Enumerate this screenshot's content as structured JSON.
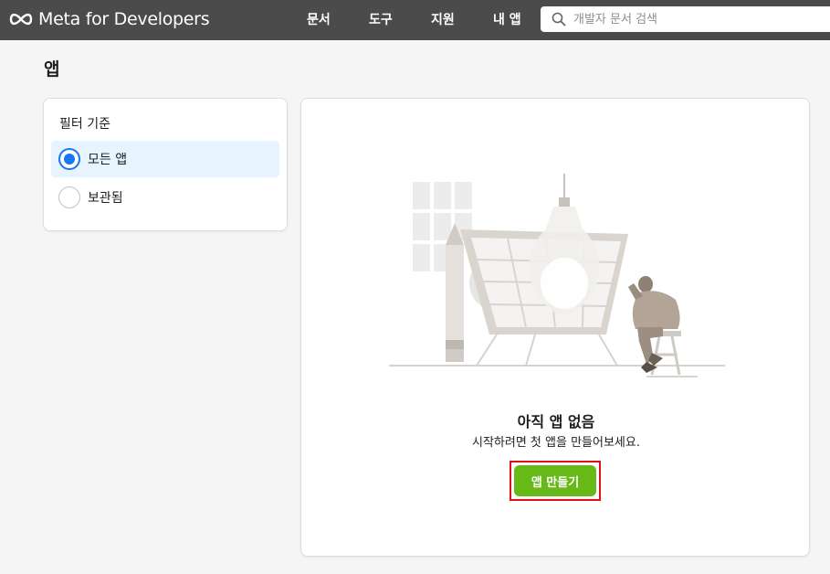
{
  "header": {
    "brand": "Meta for Developers",
    "nav": [
      {
        "label": "문서"
      },
      {
        "label": "도구"
      },
      {
        "label": "지원"
      },
      {
        "label": "내 앱"
      }
    ],
    "search": {
      "placeholder": "개발자 문서 검색",
      "value": ""
    }
  },
  "page": {
    "title": "앱"
  },
  "filter": {
    "title": "필터 기준",
    "options": [
      {
        "label": "모든 앱",
        "selected": true
      },
      {
        "label": "보관됨",
        "selected": false
      }
    ]
  },
  "empty_state": {
    "title": "아직 앱 없음",
    "subtitle": "시작하려면 첫 앱을 만들어보세요.",
    "create_button": "앱 만들기"
  },
  "colors": {
    "header_bg": "#4b4b4b",
    "accent_blue": "#1877f2",
    "selected_bg": "#e7f3ff",
    "create_green": "#67b918",
    "highlight_red": "#e0101a"
  }
}
